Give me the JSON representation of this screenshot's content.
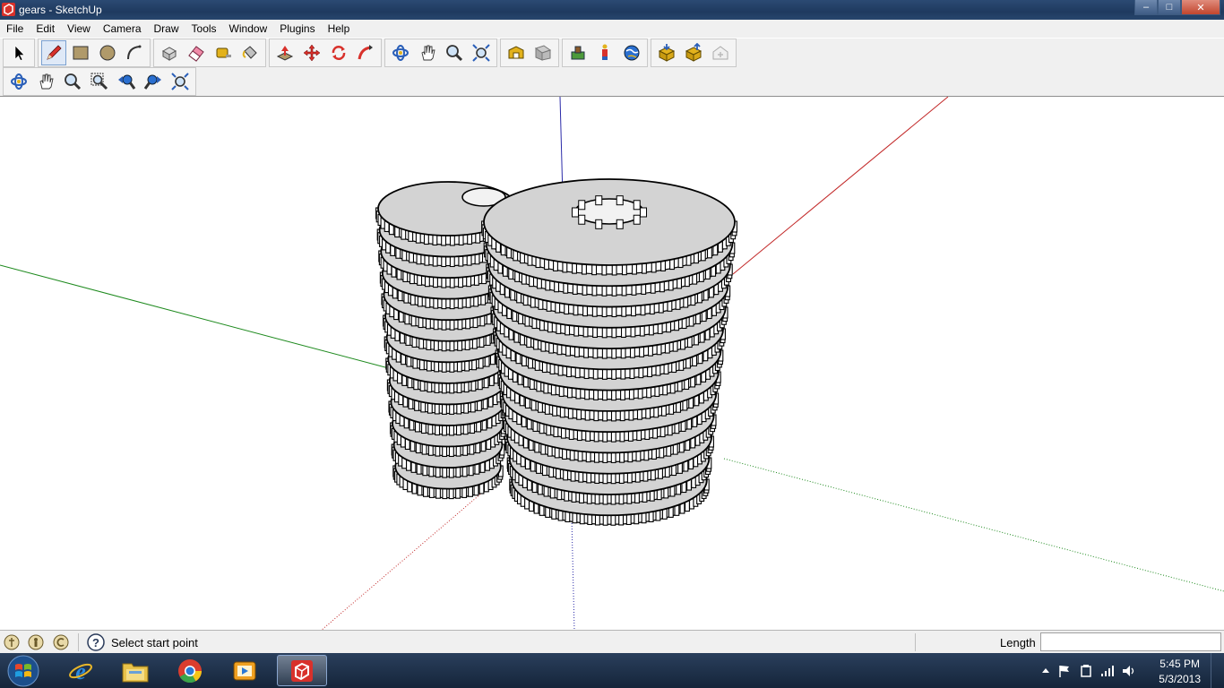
{
  "window": {
    "title": "gears - SketchUp",
    "minimize": "–",
    "maximize": "□",
    "close": "✕"
  },
  "menu": [
    "File",
    "Edit",
    "View",
    "Camera",
    "Draw",
    "Tools",
    "Window",
    "Plugins",
    "Help"
  ],
  "status": {
    "prompt": "Select start point",
    "vcb_label": "Length",
    "vcb_value": ""
  },
  "clock": {
    "time": "5:45 PM",
    "date": "5/3/2013"
  },
  "colors": {
    "red_axis": "#c22828",
    "green_axis": "#1e8a1e",
    "blue_axis": "#2a2aa8",
    "face": "#d3d3d3",
    "edge": "#000000"
  }
}
